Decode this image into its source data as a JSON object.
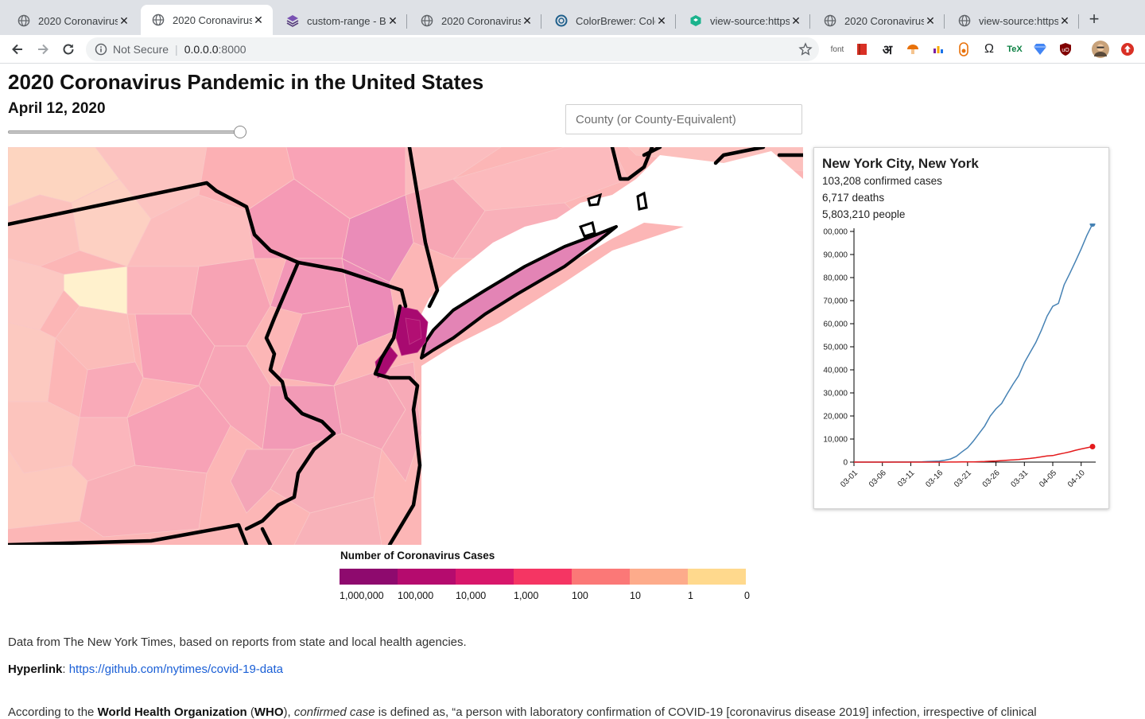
{
  "browser": {
    "tabs": [
      {
        "title": "2020 Coronavirus",
        "icon": "globe-icon",
        "active": false
      },
      {
        "title": "2020 Coronavirus",
        "icon": "globe-icon",
        "active": true
      },
      {
        "title": "custom-range - Bo",
        "icon": "bootstrap-icon",
        "active": false
      },
      {
        "title": "2020 Coronavirus",
        "icon": "globe-icon",
        "active": false
      },
      {
        "title": "ColorBrewer: Colo",
        "icon": "colorbrewer-icon",
        "active": false
      },
      {
        "title": "view-source:https",
        "icon": "codepen-icon",
        "active": false
      },
      {
        "title": "2020 Coronavirus",
        "icon": "globe-icon",
        "active": false
      },
      {
        "title": "view-source:https",
        "icon": "globe-icon",
        "active": false
      }
    ],
    "close_glyph": "✕",
    "new_tab_glyph": "+",
    "omnibox": {
      "secure_label": "Not Secure",
      "host": "0.0.0.0",
      "port": ":8000"
    },
    "extensions": {
      "font": "font",
      "hindi": "अ",
      "omega": "Ω",
      "tex": "TeX"
    }
  },
  "page": {
    "title": "2020 Coronavirus Pandemic in the United States",
    "date": "April 12, 2020",
    "slider_value_fraction": 1.0,
    "search_placeholder": "County (or County-Equivalent)"
  },
  "tooltip": {
    "place": "New York City, New York",
    "cases": "103,208 confirmed cases",
    "deaths": "6,717 deaths",
    "population": "5,803,210 people"
  },
  "chart_data": {
    "type": "line",
    "title": "",
    "xlabel": "",
    "ylabel": "",
    "x_ticks": [
      "03-01",
      "03-06",
      "03-11",
      "03-16",
      "03-21",
      "03-26",
      "03-31",
      "04-05",
      "04-10"
    ],
    "y_ticks": [
      "0",
      "10,000",
      "20,000",
      "30,000",
      "40,000",
      "50,000",
      "60,000",
      "70,000",
      "80,000",
      "90,000",
      "00,000"
    ],
    "ylim": [
      0,
      100000
    ],
    "x": [
      "03-01",
      "03-02",
      "03-03",
      "03-04",
      "03-05",
      "03-06",
      "03-07",
      "03-08",
      "03-09",
      "03-10",
      "03-11",
      "03-12",
      "03-13",
      "03-14",
      "03-15",
      "03-16",
      "03-17",
      "03-18",
      "03-19",
      "03-20",
      "03-21",
      "03-22",
      "03-23",
      "03-24",
      "03-25",
      "03-26",
      "03-27",
      "03-28",
      "03-29",
      "03-30",
      "03-31",
      "04-01",
      "04-02",
      "04-03",
      "04-04",
      "04-05",
      "04-06",
      "04-07",
      "04-08",
      "04-09",
      "04-10",
      "04-11",
      "04-12"
    ],
    "series": [
      {
        "color": "#4682b4",
        "values": [
          1,
          1,
          2,
          2,
          4,
          5,
          12,
          20,
          20,
          36,
          52,
          95,
          154,
          269,
          329,
          463,
          814,
          1339,
          2469,
          4408,
          6211,
          9045,
          12305,
          15597,
          20011,
          23112,
          25398,
          29766,
          33768,
          37453,
          43139,
          47439,
          51809,
          57159,
          63306,
          67551,
          68776,
          76876,
          81803,
          87028,
          92384,
          98308,
          103208
        ]
      },
      {
        "color": "#e41a1c",
        "values": [
          0,
          0,
          0,
          0,
          0,
          0,
          0,
          0,
          0,
          0,
          0,
          0,
          0,
          2,
          5,
          7,
          12,
          19,
          30,
          55,
          84,
          115,
          189,
          258,
          366,
          467,
          672,
          831,
          965,
          1131,
          1368,
          1571,
          1906,
          2290,
          2670,
          2815,
          3420,
          3913,
          4460,
          5155,
          5679,
          6212,
          6717
        ]
      }
    ]
  },
  "legend": {
    "title": "Number of Coronavirus Cases",
    "swatches": [
      "#8e0a6e",
      "#b50b6e",
      "#d8176b",
      "#f53563",
      "#fb7877",
      "#fdab8b",
      "#ffd98d"
    ],
    "labels": [
      "1,000,000",
      "100,000",
      "10,000",
      "1,000",
      "100",
      "10",
      "1",
      "0"
    ]
  },
  "text": {
    "source": "Data from The New York Times, based on reports from state and local health agencies.",
    "hyperlink_label": "Hyperlink",
    "hyperlink_colon": ":",
    "hyperlink_url": "https://github.com/nytimes/covid-19-data",
    "who_prefix": "According to the ",
    "who_org": "World Health Organization",
    "who_open": " (",
    "who_abbr": "WHO",
    "who_mid": "), ",
    "who_term": "confirmed case",
    "who_rest": " is defined as, “a person with laboratory confirmation of COVID-19 [coronavirus disease 2019] infection, irrespective of clinical"
  }
}
